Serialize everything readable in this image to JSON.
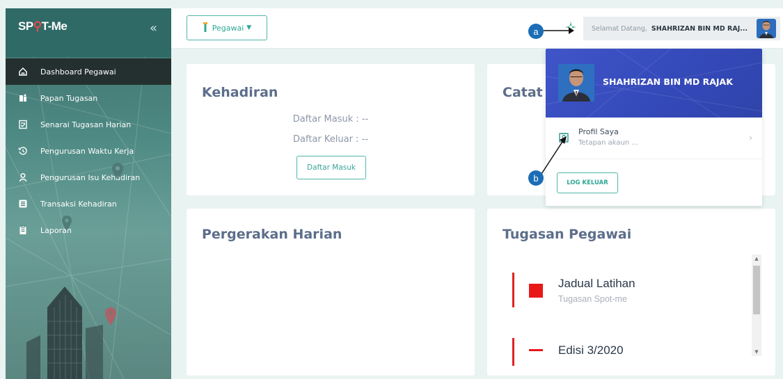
{
  "sidebar": {
    "brand_pre": "SP",
    "brand_pin": "ɸ",
    "brand_post": "T-Me",
    "collapse_glyph": "«",
    "items": [
      {
        "label": "Dashboard Pegawai",
        "icon": "home-icon",
        "active": true
      },
      {
        "label": "Papan Tugasan",
        "icon": "clipboard-icon"
      },
      {
        "label": "Senarai Tugasan Harian",
        "icon": "checklist-icon"
      },
      {
        "label": "Pengurusan Waktu Kerja",
        "icon": "clock-icon"
      },
      {
        "label": "Pengurusan Isu Kehadiran",
        "icon": "person-icon"
      },
      {
        "label": "Transaksi Kehadiran",
        "icon": "list-icon"
      },
      {
        "label": "Laporan",
        "icon": "report-icon"
      }
    ]
  },
  "topbar": {
    "role_label": "Pegawai",
    "welcome_prefix": "Selamat Datang,",
    "welcome_name": "SHAHRIZAN BIN MD RAJ...",
    "callout_a": "a",
    "callout_b": "b"
  },
  "kehadiran": {
    "title": "Kehadiran",
    "masuk_line": "Daftar Masuk : --",
    "keluar_line": "Daftar Keluar : --",
    "button_label": "Daftar Masuk"
  },
  "catatan": {
    "title": "Catat"
  },
  "pergerakan": {
    "title": "Pergerakan Harian"
  },
  "tugasan": {
    "title": "Tugasan Pegawai",
    "items": [
      {
        "title": "Jadual Latihan",
        "subtitle": "Tugasan Spot-me"
      },
      {
        "title": "Edisi 3/2020",
        "subtitle": ""
      }
    ]
  },
  "dropdown": {
    "name": "SHAHRIZAN BIN MD RAJAK",
    "profile_title": "Profil Saya",
    "profile_sub": "Tetapan akaun ...",
    "chevron": "›",
    "logout_label": "LOG KELUAR"
  },
  "colors": {
    "accent": "#2ea896",
    "sidebar_dark": "#24302f",
    "header_blue": "#3f55c9",
    "callout_blue": "#1b6db5",
    "task_red": "#e81818"
  }
}
